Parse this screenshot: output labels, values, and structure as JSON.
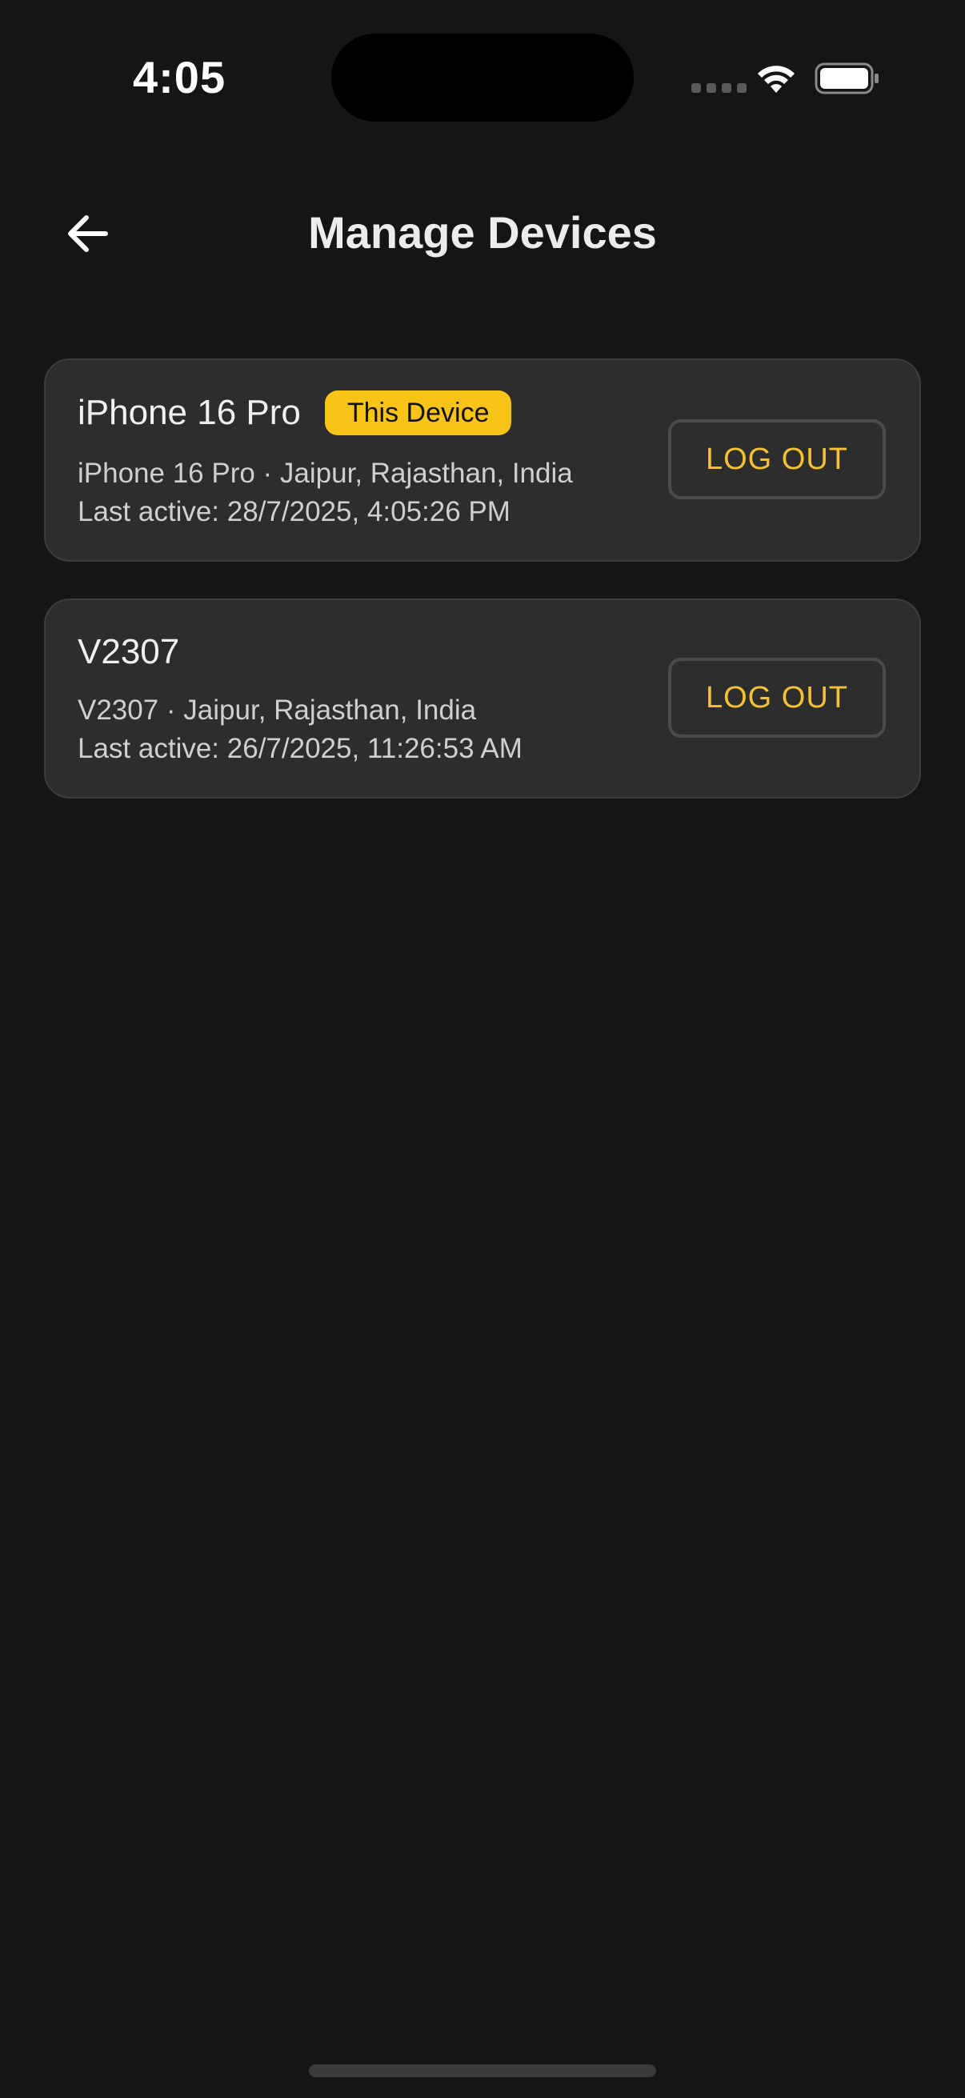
{
  "status_bar": {
    "time": "4:05",
    "wifi_icon": "wifi-icon",
    "battery_icon": "battery-icon"
  },
  "header": {
    "back_icon": "arrow-left-icon",
    "title": "Manage Devices"
  },
  "devices": [
    {
      "name": "iPhone 16 Pro",
      "badge": "This Device",
      "location": "iPhone 16 Pro · Jaipur, Rajasthan, India",
      "last_active": "Last active: 28/7/2025, 4:05:26 PM",
      "action_label": "LOG OUT"
    },
    {
      "name": "V2307",
      "location": "V2307 · Jaipur, Rajasthan, India",
      "last_active": "Last active: 26/7/2025, 11:26:53 AM",
      "action_label": "LOG OUT"
    }
  ],
  "colors": {
    "background": "#151515",
    "card": "#2d2d2d",
    "accent": "#f8c418",
    "logout_text": "#f6c134"
  }
}
